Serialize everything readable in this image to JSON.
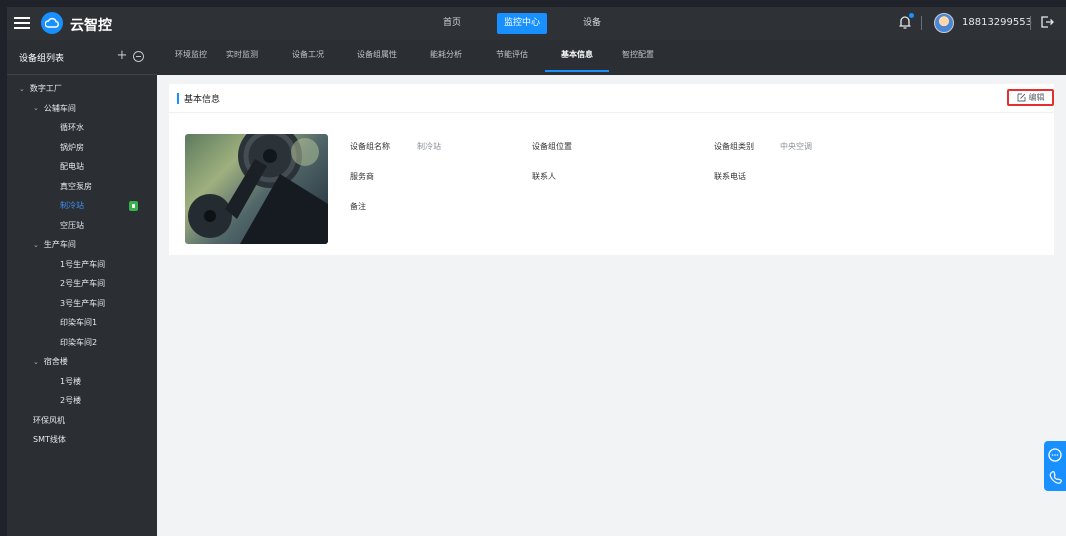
{
  "app": {
    "title": "云智控",
    "user": "18813299553"
  },
  "nav": [
    "首页",
    "监控中心",
    "设备"
  ],
  "nav_active": 1,
  "sidebar": {
    "title": "设备组列表",
    "tree": [
      {
        "label": "数字工厂",
        "level": 0,
        "expand": true
      },
      {
        "label": "公辅车间",
        "level": 1,
        "expand": true
      },
      {
        "label": "循环水",
        "level": 2
      },
      {
        "label": "锅炉房",
        "level": 2
      },
      {
        "label": "配电站",
        "level": 2
      },
      {
        "label": "真空泵房",
        "level": 2
      },
      {
        "label": "制冷站",
        "level": 2,
        "active": true
      },
      {
        "label": "空压站",
        "level": 2
      },
      {
        "label": "生产车间",
        "level": 1,
        "expand": true
      },
      {
        "label": "1号生产车间",
        "level": 2
      },
      {
        "label": "2号生产车间",
        "level": 2
      },
      {
        "label": "3号生产车间",
        "level": 2
      },
      {
        "label": "印染车间1",
        "level": 2
      },
      {
        "label": "印染车间2",
        "level": 2
      },
      {
        "label": "宿舍楼",
        "level": 1,
        "expand": true
      },
      {
        "label": "1号楼",
        "level": 2
      },
      {
        "label": "2号楼",
        "level": 2
      },
      {
        "label": "环保风机",
        "level": 1
      },
      {
        "label": "SMT线体",
        "level": 1
      }
    ]
  },
  "tabs": [
    "环境监控",
    "实时监测",
    "设备工况",
    "设备组属性",
    "能耗分析",
    "节能评估",
    "基本信息",
    "智控配置"
  ],
  "tab_active": 6,
  "card": {
    "title": "基本信息",
    "edit_label": "编辑",
    "fields": {
      "name_label": "设备组名称",
      "name_value": "制冷站",
      "location_label": "设备组位置",
      "location_value": "",
      "type_label": "设备组类别",
      "type_value": "中央空调",
      "vendor_label": "服务商",
      "vendor_value": "",
      "contact_label": "联系人",
      "contact_value": "",
      "phone_label": "联系电话",
      "phone_value": "",
      "remark_label": "备注",
      "remark_value": ""
    }
  },
  "colors": {
    "accent": "#1890ff",
    "topbar": "#2e3135",
    "sidebar": "#2b2e33",
    "highlight": "#e62e2e"
  }
}
